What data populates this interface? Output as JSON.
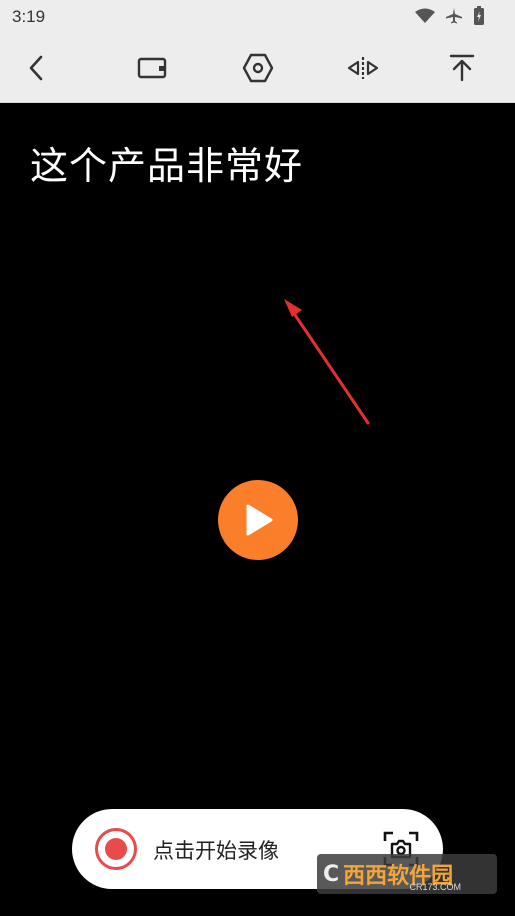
{
  "status_bar": {
    "time": "3:19",
    "icons": [
      "wifi-icon",
      "airplane-icon",
      "battery-icon"
    ]
  },
  "toolbar": {
    "items": [
      "back-icon",
      "wallet-icon",
      "settings-hexagon-icon",
      "mirror-flip-icon",
      "scroll-to-top-icon"
    ]
  },
  "prompt": {
    "text": "这个产品非常好"
  },
  "recorder": {
    "label": "点击开始录像"
  },
  "watermark": {
    "text": "西西软件园",
    "sub": "CR173.COM"
  },
  "colors": {
    "play": "#fb7e2a",
    "record": "#e94b4b",
    "arrow": "#e53030"
  }
}
